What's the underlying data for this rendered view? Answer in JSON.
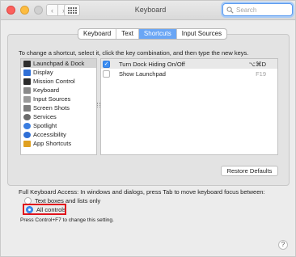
{
  "window": {
    "title": "Keyboard"
  },
  "search": {
    "placeholder": "Search"
  },
  "tabs": [
    {
      "label": "Keyboard",
      "active": false
    },
    {
      "label": "Text",
      "active": false
    },
    {
      "label": "Shortcuts",
      "active": true
    },
    {
      "label": "Input Sources",
      "active": false
    }
  ],
  "instruction": "To change a shortcut, select it, click the key combination, and then type the new keys.",
  "categories": [
    {
      "label": "Launchpad & Dock",
      "icon": "launchpad-dock-icon",
      "color": "#2d2d2d",
      "selected": true
    },
    {
      "label": "Display",
      "icon": "display-icon",
      "color": "#2f6fd6"
    },
    {
      "label": "Mission Control",
      "icon": "mission-control-icon",
      "color": "#2b2b2b"
    },
    {
      "label": "Keyboard",
      "icon": "keyboard-icon",
      "color": "#8a8a8a"
    },
    {
      "label": "Input Sources",
      "icon": "input-sources-icon",
      "color": "#9a9a9a"
    },
    {
      "label": "Screen Shots",
      "icon": "screen-shots-icon",
      "color": "#7d7d7d"
    },
    {
      "label": "Services",
      "icon": "services-gear-icon",
      "color": "#6a6a6a"
    },
    {
      "label": "Spotlight",
      "icon": "spotlight-icon",
      "color": "#3a7de0"
    },
    {
      "label": "Accessibility",
      "icon": "accessibility-icon",
      "color": "#2f6fd6"
    },
    {
      "label": "App Shortcuts",
      "icon": "app-shortcuts-icon",
      "color": "#e0a020"
    }
  ],
  "shortcuts": [
    {
      "label": "Turn Dock Hiding On/Off",
      "keys": "⌥⌘D",
      "checked": true
    },
    {
      "label": "Show Launchpad",
      "keys": "F19",
      "checked": false
    }
  ],
  "restore_label": "Restore Defaults",
  "fka_label": "Full Keyboard Access: In windows and dialogs, press Tab to move keyboard focus between:",
  "radio_options": [
    {
      "label": "Text boxes and lists only",
      "selected": false
    },
    {
      "label": "All controls",
      "selected": true
    }
  ],
  "note": "Press Control+F7 to change this setting.",
  "help_label": "?",
  "colors": {
    "accent": "#3d8ef2",
    "highlight_box": "#e0141c"
  }
}
